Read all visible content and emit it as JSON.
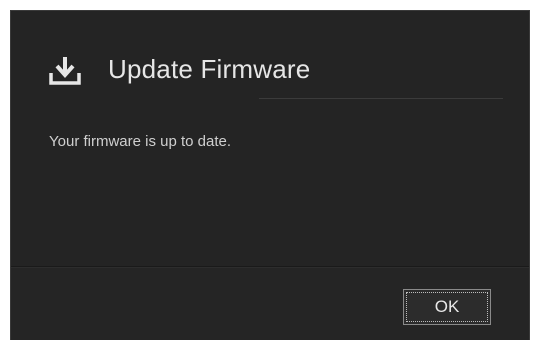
{
  "dialog": {
    "title": "Update Firmware",
    "title_icon": "download-icon",
    "message": "Your firmware is up to date.",
    "ok_label": "OK"
  },
  "colors": {
    "dialog_background": "#242424",
    "title_text": "#e6e6e6",
    "body_text": "#cfcfcf"
  }
}
